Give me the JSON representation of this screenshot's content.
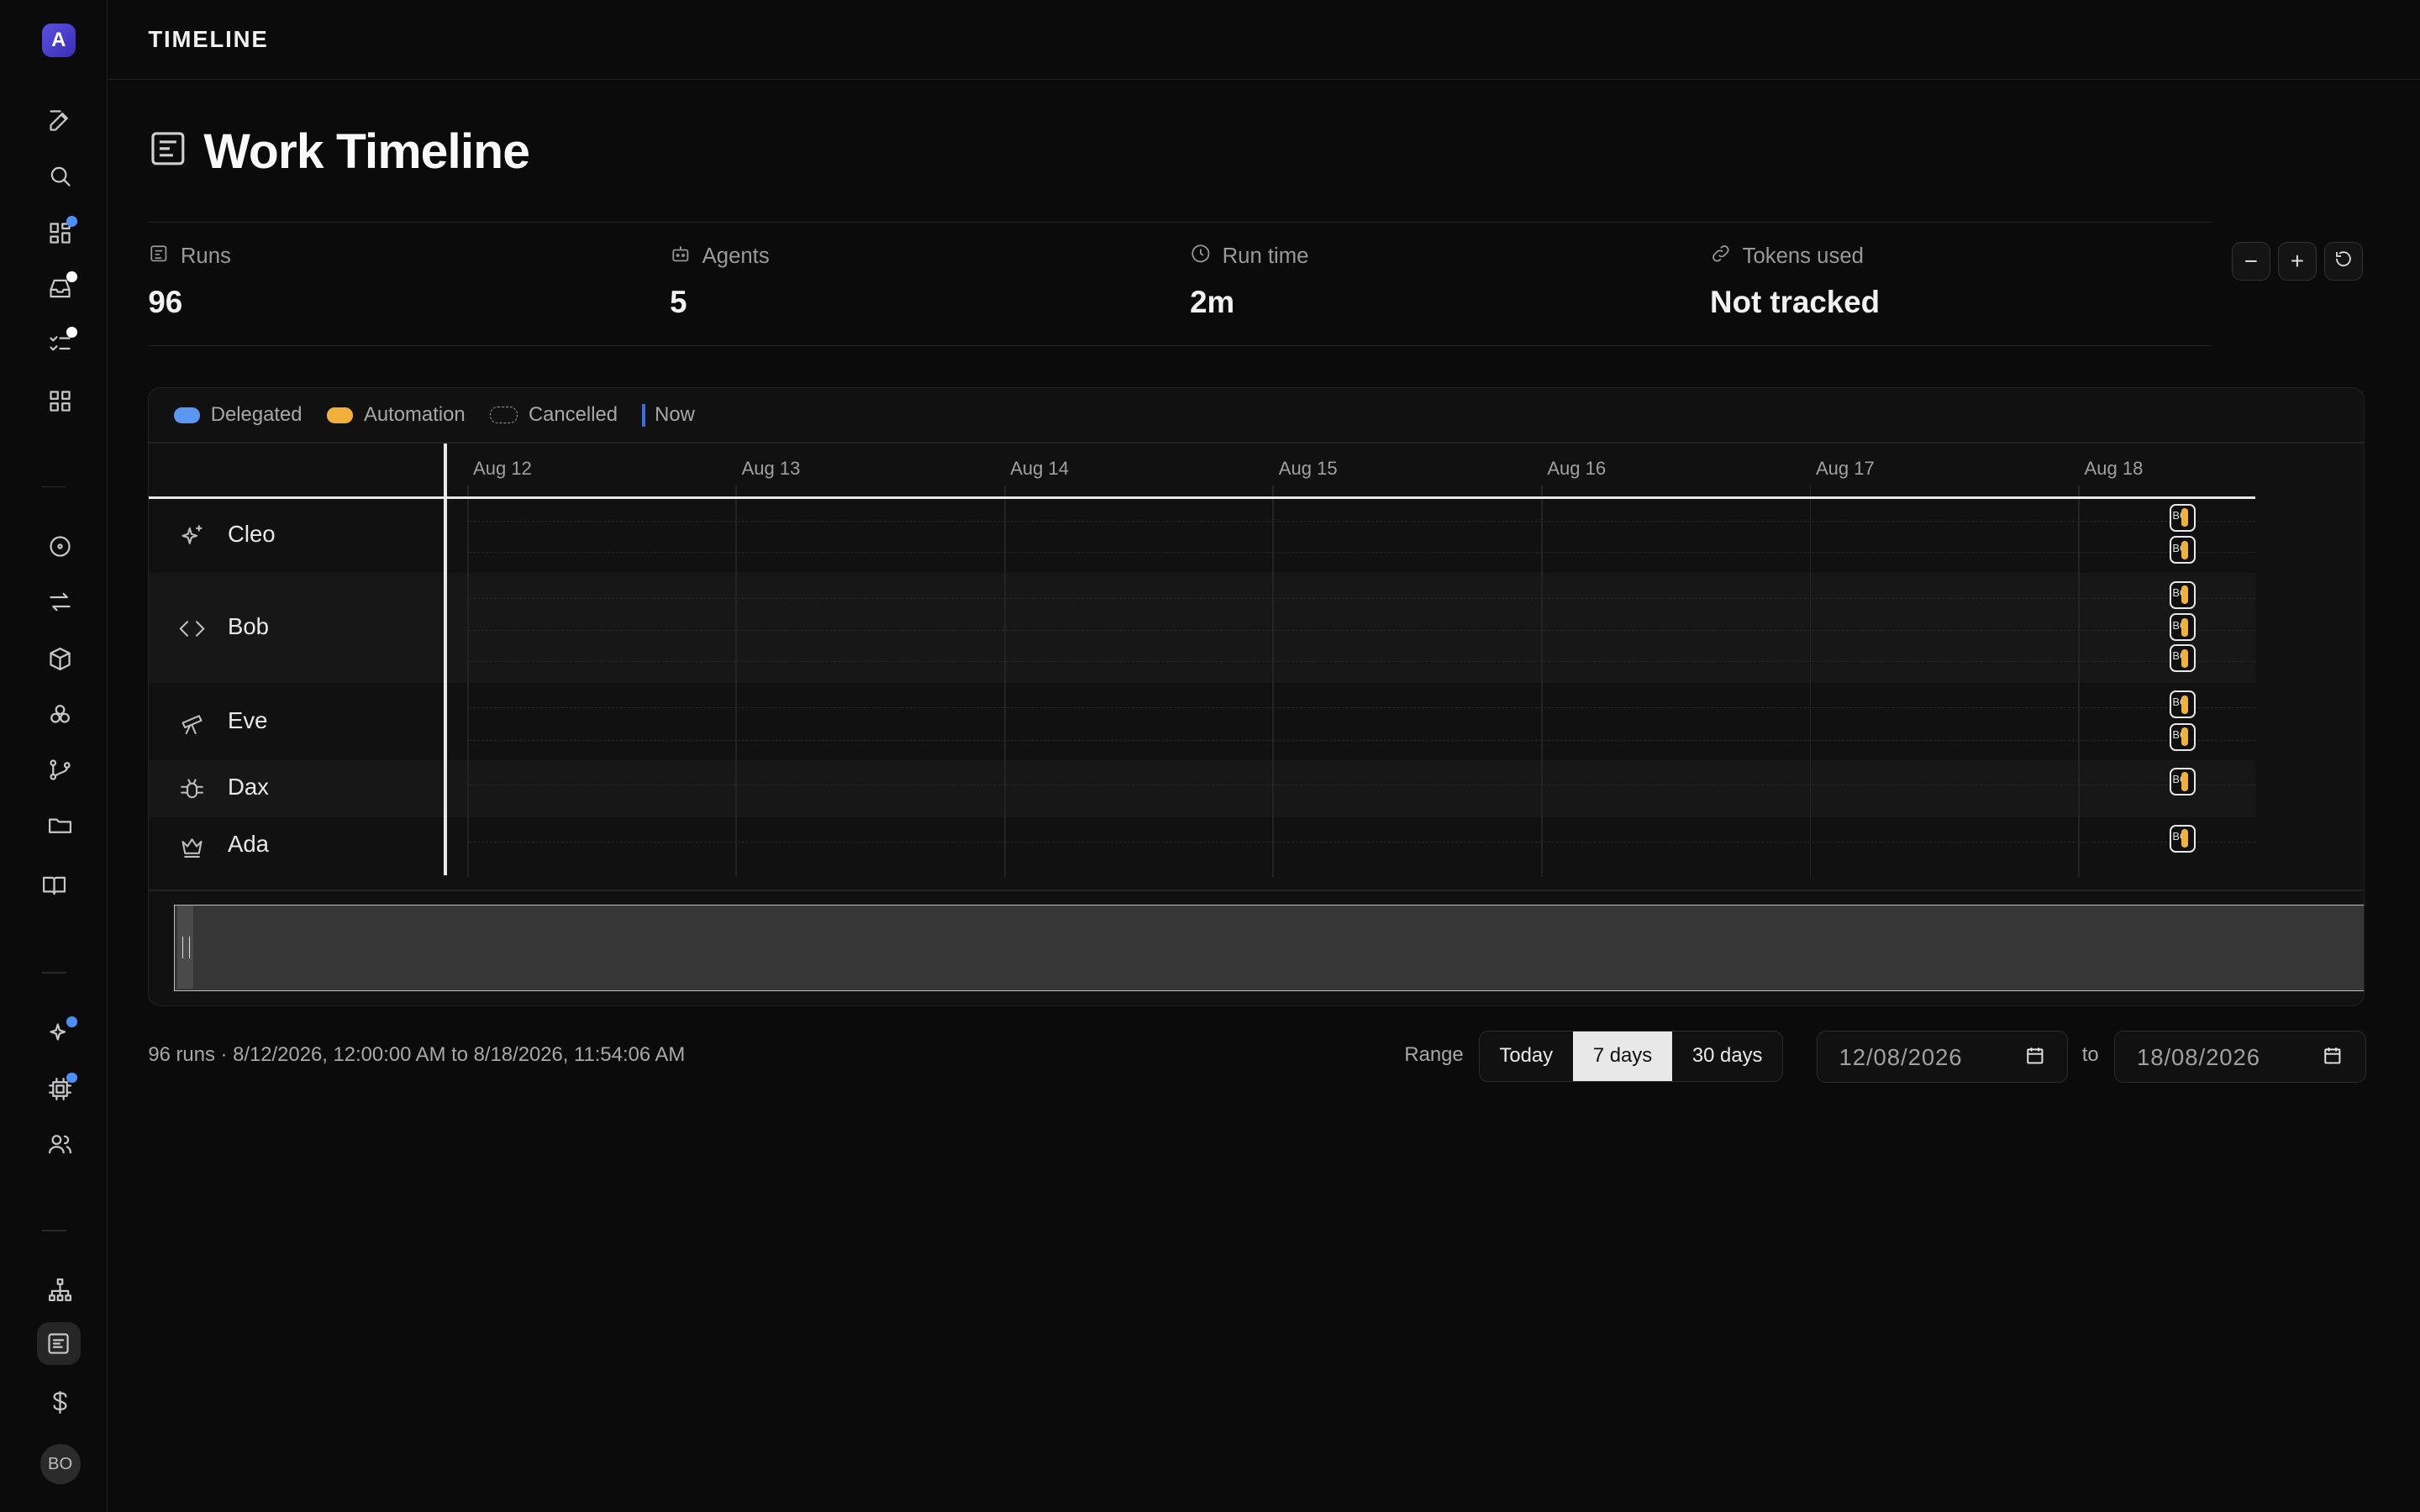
{
  "app": {
    "logo_letter": "A",
    "header_title": "TIMELINE",
    "user_initials": "BO"
  },
  "sidebar": {
    "items": [
      {
        "icon": "edit-icon"
      },
      {
        "icon": "search-icon"
      },
      {
        "icon": "dashboard-icon",
        "badge": "blue"
      },
      {
        "icon": "inbox-icon",
        "badge": "white"
      },
      {
        "icon": "checklist-icon",
        "badge": "white"
      },
      {
        "icon": "apps-grid-icon"
      },
      {
        "icon": "circle-dot-icon"
      },
      {
        "icon": "sync-icon"
      },
      {
        "icon": "package-icon"
      },
      {
        "icon": "components-icon"
      },
      {
        "icon": "git-branch-icon"
      },
      {
        "icon": "folder-icon"
      },
      {
        "icon": "book-icon"
      },
      {
        "icon": "sparkles-icon",
        "badge": "blue"
      },
      {
        "icon": "cpu-icon",
        "badge": "blue"
      },
      {
        "icon": "users-icon"
      },
      {
        "icon": "org-chart-icon"
      },
      {
        "icon": "timeline-icon",
        "active": true
      },
      {
        "icon": "dollar-icon"
      }
    ]
  },
  "page": {
    "title": "Work Timeline"
  },
  "stats": [
    {
      "label": "Runs",
      "value": "96",
      "icon": "runs-icon"
    },
    {
      "label": "Agents",
      "value": "5",
      "icon": "robot-icon"
    },
    {
      "label": "Run time",
      "value": "2m",
      "icon": "clock-icon"
    },
    {
      "label": "Tokens used",
      "value": "Not tracked",
      "icon": "link-icon"
    }
  ],
  "zoom_controls": {
    "zoom_out": "−",
    "zoom_in": "+",
    "reset": "reset-icon"
  },
  "legend": {
    "delegated": "Delegated",
    "automation": "Automation",
    "cancelled": "Cancelled",
    "now": "Now"
  },
  "colors": {
    "delegated": "#5b97f0",
    "automation": "#f0b13a",
    "now": "#3a6fe0",
    "accent": "#5c4fe0"
  },
  "timeline": {
    "days": [
      "Aug 12",
      "Aug 13",
      "Aug 14",
      "Aug 15",
      "Aug 16",
      "Aug 17",
      "Aug 18"
    ],
    "run_label": "BO",
    "agents": [
      {
        "name": "Cleo",
        "icon": "sparkles-icon",
        "runs": 2
      },
      {
        "name": "Bob",
        "icon": "code-icon",
        "runs": 3
      },
      {
        "name": "Eve",
        "icon": "telescope-icon",
        "runs": 2
      },
      {
        "name": "Dax",
        "icon": "bug-icon",
        "runs": 1
      },
      {
        "name": "Ada",
        "icon": "crown-icon",
        "runs": 1
      }
    ]
  },
  "footer": {
    "summary": "96 runs · 8/12/2026, 12:00:00 AM to 8/18/2026, 11:54:06 AM",
    "range_label": "Range",
    "range_options": [
      "Today",
      "7 days",
      "30 days"
    ],
    "range_selected": "7 days",
    "from_date": "12/08/2026",
    "to_label": "to",
    "to_date": "18/08/2026"
  }
}
